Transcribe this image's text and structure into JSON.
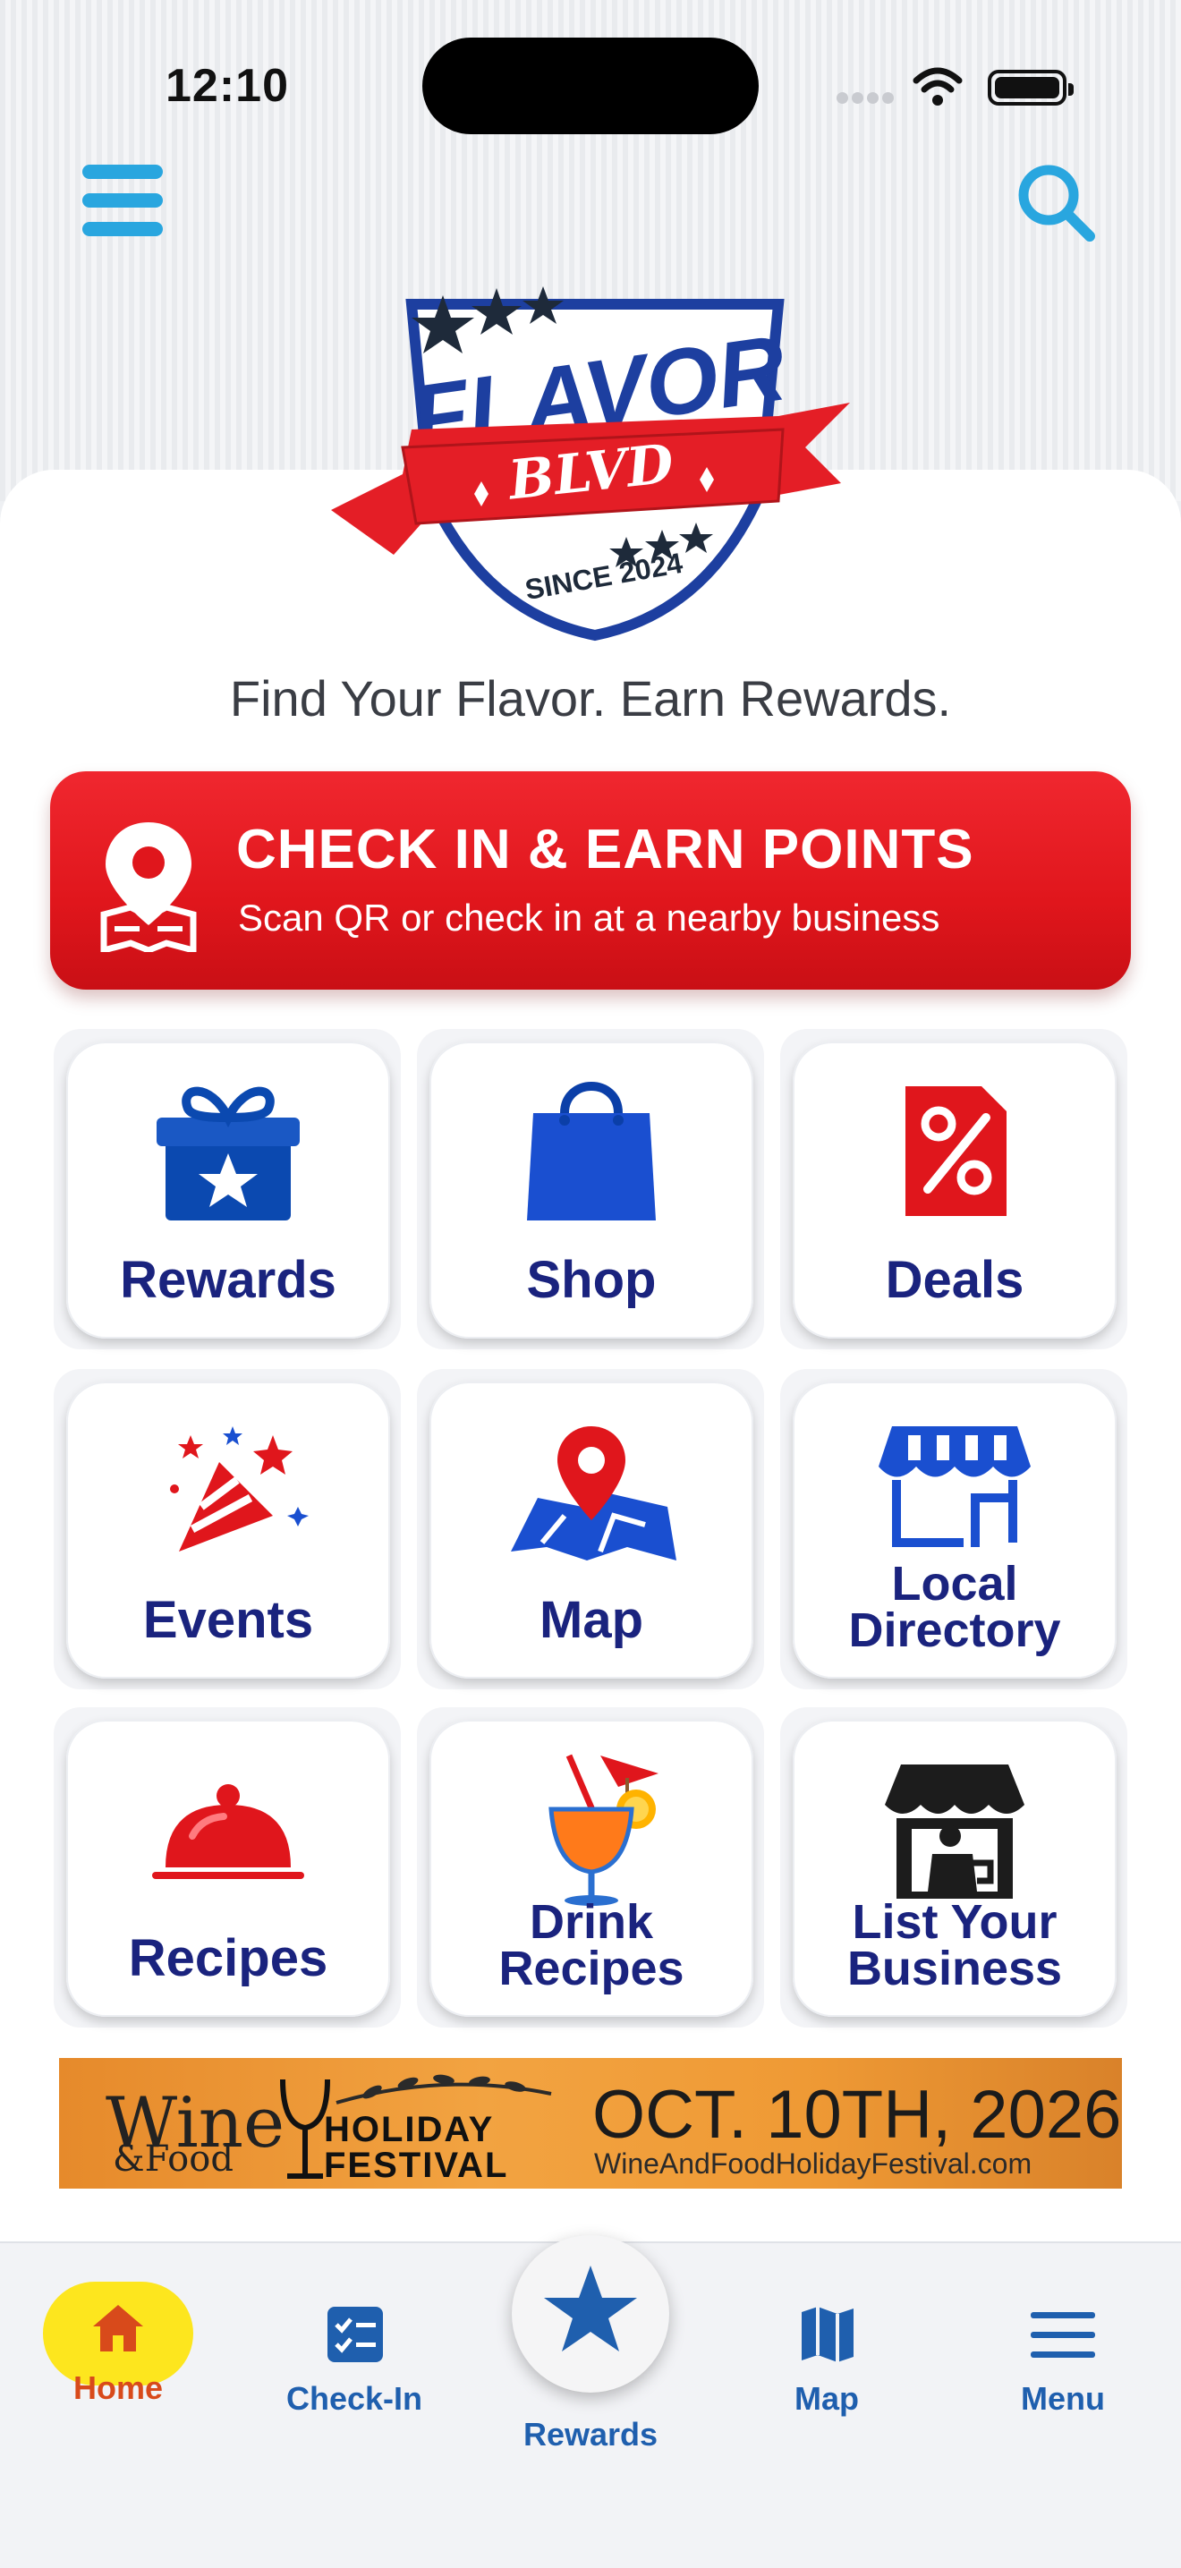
{
  "status_bar": {
    "time": "12:10"
  },
  "brand": {
    "logo_word": "FLAVOR",
    "logo_sub": "BLVD",
    "logo_since": "SINCE 2024"
  },
  "tagline": "Find Your Flavor. Earn Rewards.",
  "checkin_banner": {
    "title": "CHECK IN & EARN POINTS",
    "subtitle": "Scan QR or check in at a nearby business",
    "icon": "location-pin-map-icon"
  },
  "tiles": [
    {
      "label": "Rewards",
      "icon": "gift-icon"
    },
    {
      "label": "Shop",
      "icon": "shopping-bag-icon"
    },
    {
      "label": "Deals",
      "icon": "percent-tag-icon"
    },
    {
      "label": "Events",
      "icon": "party-popper-icon"
    },
    {
      "label": "Map",
      "icon": "map-pin-icon"
    },
    {
      "label_line1": "Local",
      "label_line2": "Directory",
      "icon": "storefront-icon"
    },
    {
      "label": "Recipes",
      "icon": "cloche-icon"
    },
    {
      "label_line1": "Drink",
      "label_line2": "Recipes",
      "icon": "cocktail-icon"
    },
    {
      "label_line1": "List Your",
      "label_line2": "Business",
      "icon": "shop-owner-icon"
    }
  ],
  "ad_banner": {
    "brand_word": "Wine",
    "brand_amp": "&Food",
    "holiday_line1": "HOLIDAY",
    "holiday_line2": "FESTIVAL",
    "date": "OCT. 10TH, 2026",
    "site": "WineAndFoodHolidayFestival.com"
  },
  "tab_bar": {
    "home": "Home",
    "checkin": "Check-In",
    "rewards": "Rewards",
    "map": "Map",
    "menu": "Menu"
  },
  "colors": {
    "accent_blue": "#29a6df",
    "brand_navy": "#1a237e",
    "brand_red": "#e0161c",
    "home_pill": "#fde61e",
    "tab_blue": "#1f5fae",
    "home_active": "#d84a1b"
  }
}
